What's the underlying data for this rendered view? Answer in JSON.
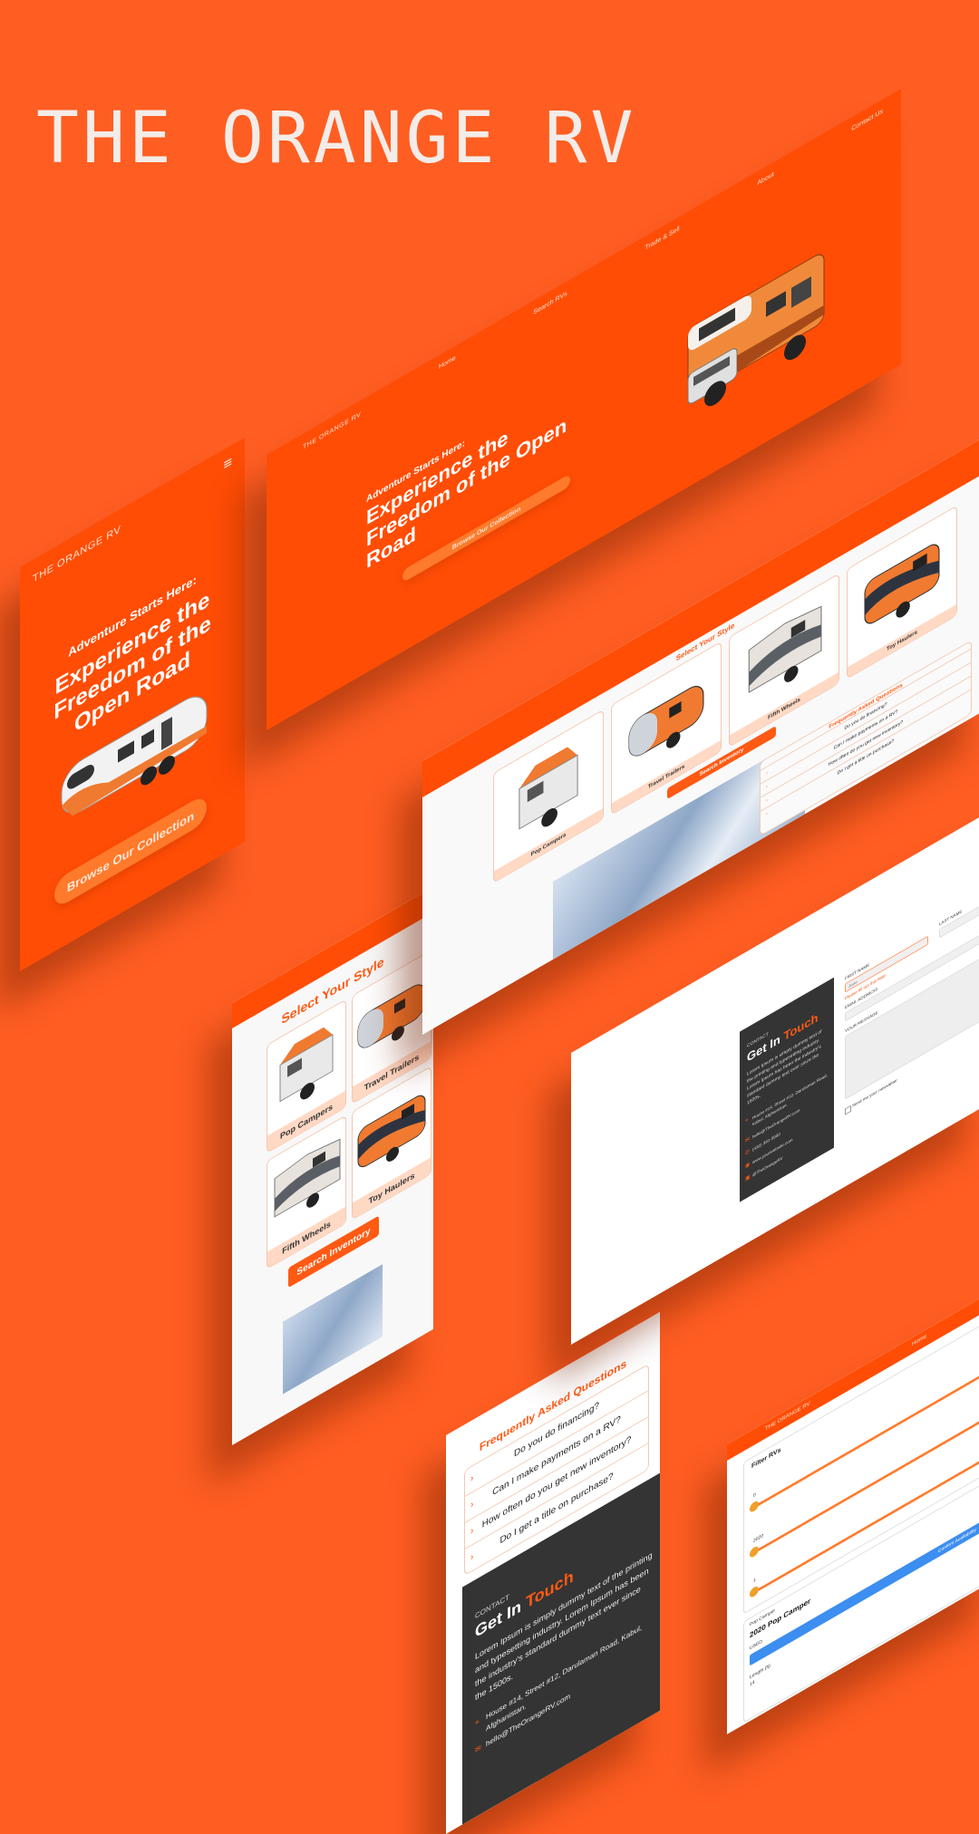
{
  "brand": {
    "title": "THE ORANGE RV"
  },
  "mobile_hero": {
    "logo": "THE ORANGE RV",
    "menu_icon": "hamburger-icon",
    "eyebrow": "Adventure Starts Here:",
    "headline": "Experience the Freedom of the Open Road",
    "cta": "Browse Our Collection"
  },
  "desktop_hero": {
    "logo": "THE ORANGE RV",
    "nav": [
      "Home",
      "Search RVs",
      "Trade & Sell",
      "About",
      "Contact Us"
    ],
    "eyebrow": "Adventure Starts Here:",
    "headline": "Experience the Freedom of the Open Road",
    "cta": "Browse Our Collection"
  },
  "styles_section": {
    "title": "Select Your Style",
    "items": [
      "Pop Campers",
      "Travel Trailers",
      "Fifth Wheels",
      "Toy Haulers"
    ],
    "cta": "Search Inventory"
  },
  "faq": {
    "title": "Frequently Asked Questions",
    "questions": [
      "Do you do financing?",
      "Can I make payments on a RV?",
      "How often do you get new inventory?",
      "Do I get a title on purchase?"
    ]
  },
  "contact": {
    "eyebrow": "CONTACT",
    "title_a": "Get In",
    "title_b": "Touch",
    "body": "Lorem Ipsum is simply dummy text of the printing and typesetting industry. Lorem Ipsum has been the industry's standard dummy text ever since the 1500s.",
    "address": "House #14, Street #12, Darulaman Road, Kabul, Afghanistan.",
    "email": "hello@TheOrangeRV.com",
    "phone": "(432) 391-3900",
    "website": "www.yourwebsite.com",
    "facebook": "@TheOrangeRV",
    "form": {
      "first_name": "FIRST NAME",
      "first_placeholder": "Jane",
      "error": "Please fill out this field",
      "last_name": "LAST NAME",
      "email_label": "EMAIL ADDRESS",
      "message_label": "YOUR MESSAGE",
      "checkbox": "Send me your newsletter"
    }
  },
  "search_page": {
    "logo": "THE ORANGE RV",
    "nav_home": "Home",
    "filter_title": "Filter RVs",
    "filter_values": [
      "0",
      "2020",
      "1"
    ],
    "filter_levels": [
      0.02,
      0.02,
      0.02
    ],
    "result_tag": "Pop Camper",
    "result_title": "2020 Pop Camper",
    "result_condition": "USED",
    "result_button": "Confirm Availability",
    "result_spec_label": "Length (ft)",
    "result_spec_value": "14"
  },
  "colors": {
    "brand_orange": "#ff4d05",
    "background": "#ff5e22",
    "dark": "#343434"
  }
}
